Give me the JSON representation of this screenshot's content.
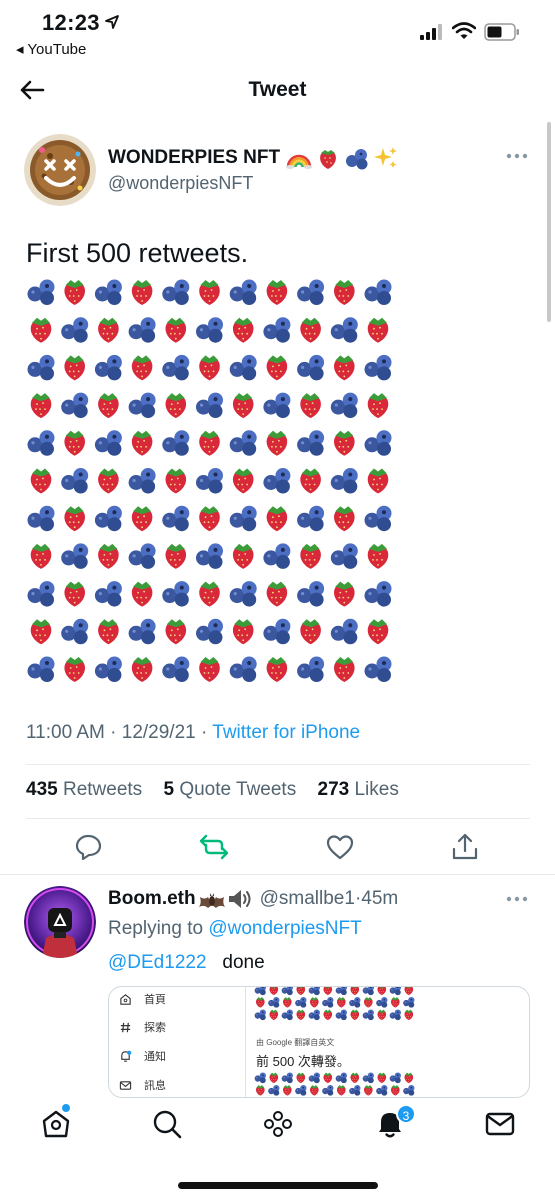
{
  "status_bar": {
    "time": "12:23",
    "back_app": "◂ YouTube"
  },
  "header": {
    "title": "Tweet"
  },
  "tweet": {
    "author_name": "WONDERPIES NFT",
    "author_emojis": [
      "rainbow-icon",
      "strawberry-icon",
      "blueberries-icon",
      "sparkles-icon"
    ],
    "author_handle": "@wonderpiesNFT",
    "text": "First 500 retweets.",
    "emoji_grid": {
      "rows": 11,
      "cols": 11,
      "pattern": "alternating blueberries and strawberries"
    },
    "time": "11:00 AM",
    "date": "12/29/21",
    "meta_separator": " · ",
    "source": "Twitter for iPhone",
    "stats": {
      "retweets_count": "435",
      "retweets_label": "Retweets",
      "quotes_count": "5",
      "quotes_label": "Quote Tweets",
      "likes_count": "273",
      "likes_label": "Likes"
    },
    "accent_color": "#1d9bf0",
    "retweet_color": "#00ba7c"
  },
  "reply": {
    "author_name": "Boom.eth",
    "author_emojis": [
      "bat-icon",
      "speaker-icon"
    ],
    "author_handle": "@smallbe1",
    "time": "45m",
    "separator": " · ",
    "replying_prefix": "Replying to ",
    "replying_handle": "@wonderpiesNFT",
    "mention": "@DEd1222",
    "text": "done",
    "embed": {
      "menu_items": [
        "首頁",
        "探索",
        "通知",
        "訊息"
      ],
      "translate_label": "由 Google 翻譯自英文",
      "translated_text": "前 500 次轉發。"
    }
  },
  "tab_bar": {
    "notification_count": "3",
    "tabs": [
      "home-icon",
      "search-icon",
      "spaces-icon",
      "notifications-icon",
      "messages-icon"
    ]
  }
}
